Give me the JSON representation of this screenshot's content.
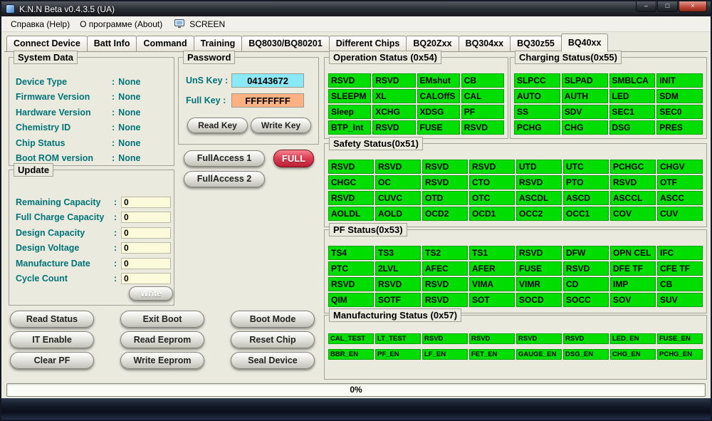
{
  "window": {
    "title": "K.N.N Beta v0.4.3.5 (UA)",
    "minimize": "–",
    "maximize": "□",
    "close": "×"
  },
  "menu": {
    "help": "Справка (Help)",
    "about": "О программе (About)",
    "screen": "SCREEN"
  },
  "tabs": {
    "items": [
      "Connect Device",
      "Batt Info",
      "Command",
      "Training",
      "BQ8030/BQ80201",
      "Different Chips",
      "BQ20Zxx",
      "BQ304xx",
      "BQ30z55",
      "BQ40xx"
    ],
    "active": "BQ40xx"
  },
  "system_data": {
    "title": "System Data",
    "rows": [
      {
        "label": "Device Type",
        "sep": ":",
        "value": "None"
      },
      {
        "label": "Firmware Version",
        "sep": ":",
        "value": "None"
      },
      {
        "label": "Hardware Version",
        "sep": ":",
        "value": "None"
      },
      {
        "label": "Chemistry ID",
        "sep": ":",
        "value": "None"
      },
      {
        "label": "Chip Status",
        "sep": ":",
        "value": "None"
      },
      {
        "label": "Boot ROM version",
        "sep": ":",
        "value": "None"
      }
    ]
  },
  "update": {
    "title": "Update",
    "rows": [
      {
        "label": "Remaining Capacity",
        "sep": ":",
        "value": "0"
      },
      {
        "label": "Full Charge Capacity",
        "sep": ":",
        "value": "0"
      },
      {
        "label": "Design Capacity",
        "sep": ":",
        "value": "0"
      },
      {
        "label": "Design Voltage",
        "sep": ":",
        "value": "0"
      },
      {
        "label": "Manufacture Date",
        "sep": ":",
        "value": "0"
      },
      {
        "label": "Cycle Count",
        "sep": ":",
        "value": "0"
      }
    ],
    "write_button": "Write"
  },
  "password": {
    "title": "Password",
    "uns_key_label": "UnS Key :",
    "uns_key_value": "04143672",
    "full_key_label": "Full Key :",
    "full_key_value": "FFFFFFFF",
    "read_key": "Read Key",
    "write_key": "Write Key",
    "full_access_1": "FullAccess 1",
    "full": "FULL",
    "full_access_2": "FullAccess 2"
  },
  "actions": [
    "Read Status",
    "Exit Boot",
    "Boot Mode",
    "IT Enable",
    "Read Eeprom",
    "Reset Chip",
    "Clear PF",
    "Write Eeprom",
    "Seal Device"
  ],
  "operation_status": {
    "title": "Operation Status (0x54)",
    "cells": [
      [
        "RSVD",
        "RSVD",
        "EMshut",
        "CB"
      ],
      [
        "SLEEPM",
        "XL",
        "CALOffS",
        "CAL"
      ],
      [
        "Sleep",
        "XCHG",
        "XDSG",
        "PF"
      ],
      [
        "BTP_Int",
        "RSVD",
        "FUSE",
        "RSVD"
      ]
    ]
  },
  "charging_status": {
    "title": "Charging Status(0x55)",
    "cells": [
      [
        "SLPCC",
        "SLPAD",
        "SMBLCA",
        "INIT"
      ],
      [
        "AUTO",
        "AUTH",
        "LED",
        "SDM"
      ],
      [
        "SS",
        "SDV",
        "SEC1",
        "SEC0"
      ],
      [
        "PCHG",
        "CHG",
        "DSG",
        "PRES"
      ]
    ]
  },
  "safety_status": {
    "title": "Safety Status(0x51)",
    "cells": [
      [
        "RSVD",
        "RSVD",
        "RSVD",
        "RSVD",
        "UTD",
        "UTC",
        "PCHGC",
        "CHGV"
      ],
      [
        "CHGC",
        "OC",
        "RSVD",
        "CTO",
        "RSVD",
        "PTO",
        "RSVD",
        "OTF"
      ],
      [
        "RSVD",
        "CUVC",
        "OTD",
        "OTC",
        "ASCDL",
        "ASCD",
        "ASCCL",
        "ASCC"
      ],
      [
        "AOLDL",
        "AOLD",
        "OCD2",
        "OCD1",
        "OCC2",
        "OCC1",
        "COV",
        "CUV"
      ]
    ]
  },
  "pf_status": {
    "title": "PF Status(0x53)",
    "cells": [
      [
        "TS4",
        "TS3",
        "TS2",
        "TS1",
        "RSVD",
        "DFW",
        "OPN CEL",
        "IFC"
      ],
      [
        "PTC",
        "2LVL",
        "AFEC",
        "AFER",
        "FUSE",
        "RSVD",
        "DFE TF",
        "CFE TF"
      ],
      [
        "RSVD",
        "RSVD",
        "RSVD",
        "VIMA",
        "VIMR",
        "CD",
        "IMP",
        "CB"
      ],
      [
        "QIM",
        "SOTF",
        "RSVD",
        "SOT",
        "SOCD",
        "SOCC",
        "SOV",
        "SUV"
      ]
    ]
  },
  "manufacturing_status": {
    "title": "Manufacturing Status (0x57)",
    "cells": [
      [
        "CAL_TEST",
        "LT_TEST",
        "RSVD",
        "RSVD",
        "RSVD",
        "RSVD",
        "LED_EN",
        "FUSE_EN"
      ],
      [
        "BBR_EN",
        "PF_EN",
        "LF_EN",
        "FET_EN",
        "GAUGE_EN",
        "DSG_EN",
        "CHG_EN",
        "PCHG_EN"
      ]
    ]
  },
  "progress": {
    "value": "0%"
  },
  "colors": {
    "green": "#00dd00",
    "cyan": "#8be9f7",
    "salmon": "#ffb183",
    "red": "#d5293d",
    "teal": "#007478",
    "cream": "#fbfbdc"
  }
}
